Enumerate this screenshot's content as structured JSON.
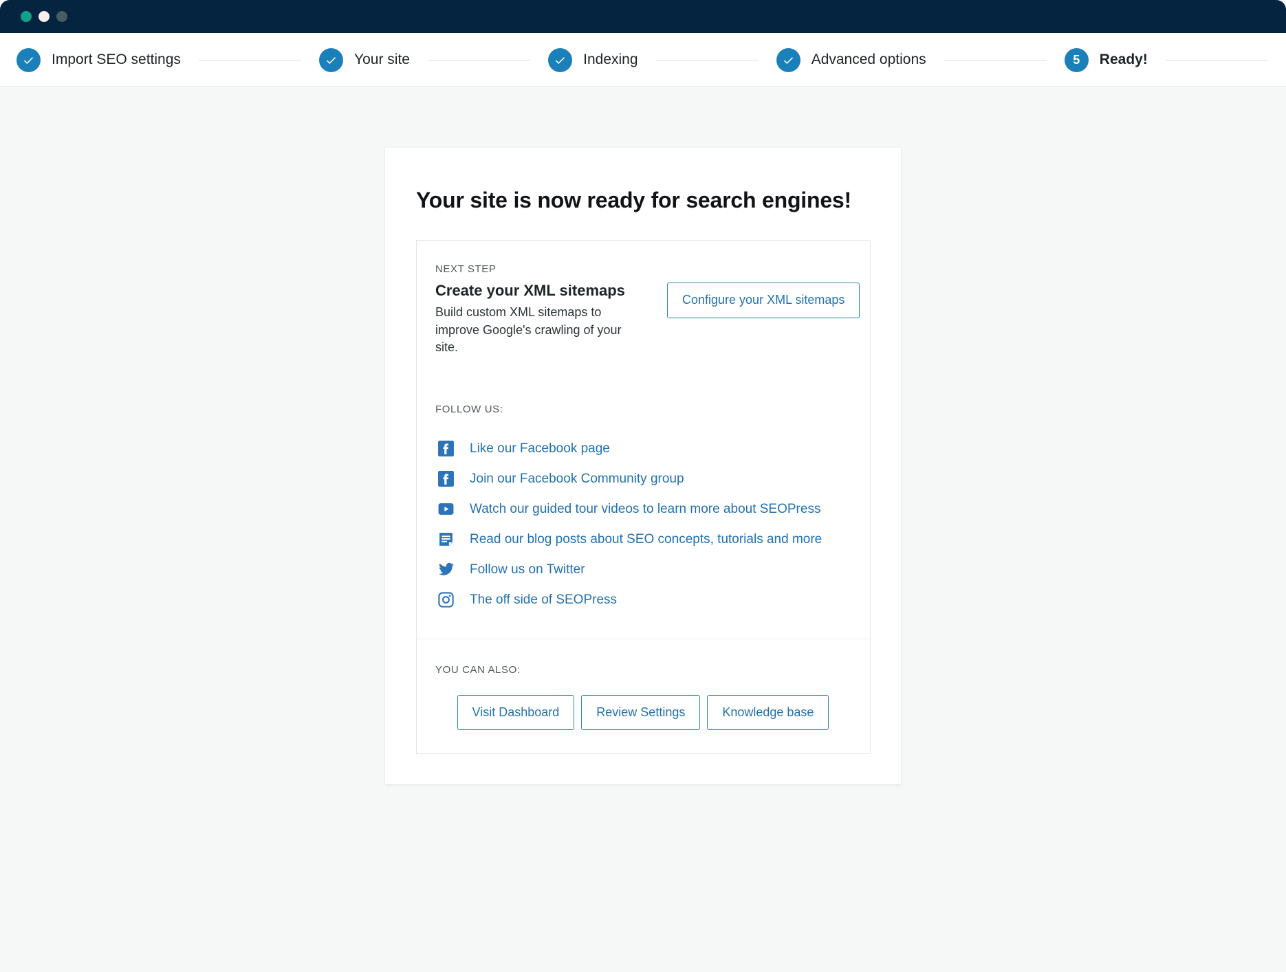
{
  "window": {
    "traffic_lights": [
      "close",
      "minimize",
      "maximize"
    ]
  },
  "stepper": {
    "steps": [
      {
        "label": "Import SEO settings",
        "state": "complete",
        "marker": "check"
      },
      {
        "label": "Your site",
        "state": "complete",
        "marker": "check"
      },
      {
        "label": "Indexing",
        "state": "complete",
        "marker": "check"
      },
      {
        "label": "Advanced options",
        "state": "complete",
        "marker": "check"
      },
      {
        "label": "Ready!",
        "state": "current",
        "marker": "5"
      }
    ],
    "accent_color": "#1b7fba"
  },
  "card": {
    "title": "Your site is now ready for search engines!",
    "next_step": {
      "eyebrow": "NEXT STEP",
      "heading": "Create your XML sitemaps",
      "description": "Build custom XML sitemaps to improve Google's crawling of your site.",
      "button_label": "Configure your XML sitemaps"
    },
    "follow": {
      "eyebrow": "FOLLOW US:",
      "items": [
        {
          "icon": "facebook-icon",
          "label": "Like our Facebook page"
        },
        {
          "icon": "facebook-icon",
          "label": "Join our Facebook Community group"
        },
        {
          "icon": "youtube-icon",
          "label": "Watch our guided tour videos to learn more about SEOPress"
        },
        {
          "icon": "blog-icon",
          "label": "Read our blog posts about SEO concepts, tutorials and more"
        },
        {
          "icon": "twitter-icon",
          "label": "Follow us on Twitter"
        },
        {
          "icon": "instagram-icon",
          "label": "The off side of SEOPress"
        }
      ]
    },
    "also": {
      "eyebrow": "YOU CAN ALSO:",
      "buttons": [
        {
          "label": "Visit Dashboard"
        },
        {
          "label": "Review Settings"
        },
        {
          "label": "Knowledge base"
        }
      ]
    }
  },
  "colors": {
    "header_bg": "#04243f",
    "accent": "#1b7fba",
    "link": "#2271b1",
    "page_bg": "#f6f7f7"
  }
}
